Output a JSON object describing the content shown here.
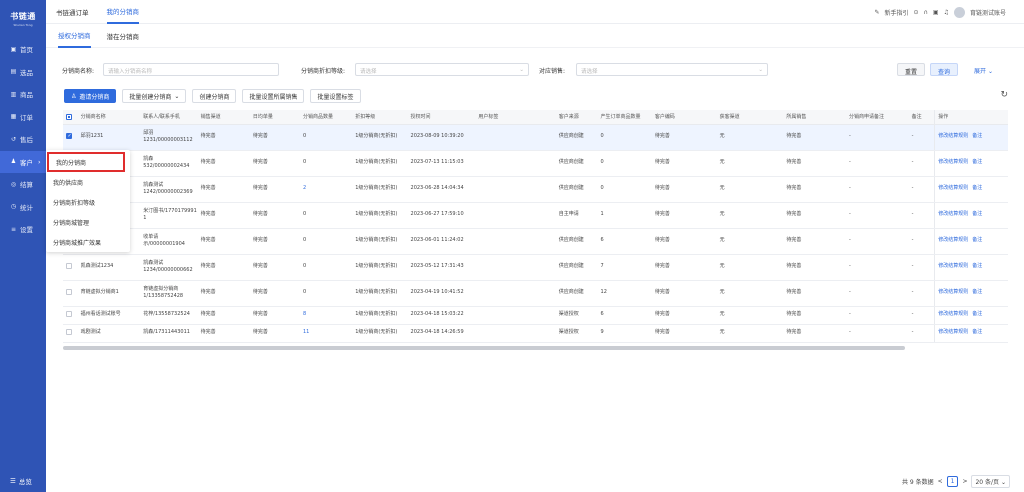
{
  "app": {
    "logo": "书链通",
    "logo_sub": "Shulian Tong"
  },
  "sidebar": {
    "items": [
      {
        "icon": "▣",
        "label": "首页"
      },
      {
        "icon": "▤",
        "label": "选品"
      },
      {
        "icon": "▥",
        "label": "商品"
      },
      {
        "icon": "▦",
        "label": "订单"
      },
      {
        "icon": "↺",
        "label": "售后"
      },
      {
        "icon": "♟",
        "label": "客户"
      },
      {
        "icon": "◎",
        "label": "结算"
      },
      {
        "icon": "◷",
        "label": "统计"
      },
      {
        "icon": "≡",
        "label": "设置"
      }
    ],
    "bottom": "总览",
    "bottom_icon": "☰"
  },
  "topbar": {
    "tabs": [
      "书链通订单",
      "我的分销商"
    ],
    "guide": "新手指引",
    "user": "育链测试账号",
    "icons": [
      "⊙",
      "∩",
      "▣",
      "♫"
    ]
  },
  "subtabs": [
    "授权分销商",
    "潜在分销商"
  ],
  "filters": {
    "name_label": "分销商名称:",
    "name_placeholder": "请输入分销商名称",
    "level_label": "分销商折扣等级:",
    "level_placeholder": "请选择",
    "sales_label": "对应销售:",
    "sales_placeholder": "请选择",
    "reset": "重置",
    "query": "查询",
    "expand": "展开"
  },
  "toolbar": {
    "invite": "邀请分销商",
    "batch_create": "批量创建分销商",
    "create": "创建分销商",
    "batch_sales": "批量设置所属销售",
    "batch_tag": "批量设置标签"
  },
  "table": {
    "headers": [
      "分销商名称",
      "联系人/联系手机",
      "销售渠道",
      "日均单量",
      "分销商品数量",
      "折扣等级",
      "授权时间",
      "用户标签",
      "客户来源",
      "产生订单商品数量",
      "客户编码",
      "获客渠道",
      "所属销售",
      "分销商申请备注",
      "备注",
      "操作"
    ],
    "rows": [
      {
        "name": "邱羽1231",
        "contact": "邱羽1231/00000003112",
        "channel": "待完善",
        "daily": "待完善",
        "count": "0",
        "level": "1级分销商(无折扣)",
        "time": "2023-08-09 10:39:20",
        "tag": "",
        "source": "供应商创建",
        "orders": "0",
        "code": "待完善",
        "acq": "无",
        "sales": "待完善",
        "apply": "-",
        "remark": "-",
        "op1": "修改结算规则",
        "op2": "备注"
      },
      {
        "name": "凯森532",
        "contact": "凯森532/00000002434",
        "channel": "待完善",
        "daily": "待完善",
        "count": "0",
        "level": "1级分销商(无折扣)",
        "time": "2023-07-13 11:15:03",
        "tag": "",
        "source": "供应商创建",
        "orders": "0",
        "code": "待完善",
        "acq": "无",
        "sales": "待完善",
        "apply": "-",
        "remark": "-",
        "op1": "修改结算规则",
        "op2": "备注"
      },
      {
        "name": "凯森测试1242",
        "contact": "凯森测试1242/00000002369",
        "channel": "待完善",
        "daily": "待完善",
        "count": "2",
        "level": "1级分销商(无折扣)",
        "time": "2023-06-28 14:04:34",
        "tag": "",
        "source": "供应商创建",
        "orders": "0",
        "code": "待完善",
        "acq": "无",
        "sales": "待完善",
        "apply": "-",
        "remark": "-",
        "op1": "修改结算规则",
        "op2": "备注"
      },
      {
        "name": "米汀图书",
        "contact": "米汀图书/1770179991 1",
        "channel": "待完善",
        "daily": "待完善",
        "count": "0",
        "level": "1级分销商(无折扣)",
        "time": "2023-06-27 17:59:10",
        "tag": "",
        "source": "自主申请",
        "orders": "1",
        "code": "待完善",
        "acq": "无",
        "sales": "待完善",
        "apply": "-",
        "remark": "-",
        "op1": "修改结算规则",
        "op2": "备注"
      },
      {
        "name": "收单请示",
        "contact": "收单请示/00000001904",
        "channel": "待完善",
        "daily": "待完善",
        "count": "0",
        "level": "1级分销商(无折扣)",
        "time": "2023-06-01 11:24:02",
        "tag": "",
        "source": "供应商创建",
        "orders": "6",
        "code": "待完善",
        "acq": "无",
        "sales": "待完善",
        "apply": "-",
        "remark": "-",
        "op1": "修改结算规则",
        "op2": "备注"
      },
      {
        "name": "凯森测试1234",
        "contact": "凯森测试1234/00000000662",
        "channel": "待完善",
        "daily": "待完善",
        "count": "0",
        "level": "1级分销商(无折扣)",
        "time": "2023-05-12 17:31:43",
        "tag": "",
        "source": "供应商创建",
        "orders": "7",
        "code": "待完善",
        "acq": "无",
        "sales": "待完善",
        "apply": "-",
        "remark": "-",
        "op1": "修改结算规则",
        "op2": "备注"
      },
      {
        "name": "育链虚拟分销商1",
        "contact": "育链虚拟分销商1/13358752428",
        "channel": "待完善",
        "daily": "待完善",
        "count": "0",
        "level": "1级分销商(无折扣)",
        "time": "2023-04-19 10:41:52",
        "tag": "",
        "source": "供应商创建",
        "orders": "12",
        "code": "待完善",
        "acq": "无",
        "sales": "待完善",
        "apply": "-",
        "remark": "-",
        "op1": "修改结算规则",
        "op2": "备注"
      },
      {
        "name": "福州看话测试账号",
        "contact": "花梓/13558732524",
        "channel": "待完善",
        "daily": "待完善",
        "count": "8",
        "level": "1级分销商(无折扣)",
        "time": "2023-04-18 15:03:22",
        "tag": "",
        "source": "渠道授权",
        "orders": "6",
        "code": "待完善",
        "acq": "无",
        "sales": "待完善",
        "apply": "-",
        "remark": "-",
        "op1": "修改结算规则",
        "op2": "备注"
      },
      {
        "name": "戏剧测试",
        "contact": "凯森/17311443011",
        "channel": "待完善",
        "daily": "待完善",
        "count": "11",
        "level": "1级分销商(无折扣)",
        "time": "2023-04-18 14:26:59",
        "tag": "",
        "source": "渠道授权",
        "orders": "9",
        "code": "待完善",
        "acq": "无",
        "sales": "待完善",
        "apply": "-",
        "remark": "-",
        "op1": "修改结算规则",
        "op2": "备注"
      }
    ]
  },
  "dropdown": [
    "我的分销商",
    "我的供应商",
    "分销商折扣等级",
    "分销商城管理",
    "分销商城推广效果"
  ],
  "pager": {
    "total": "共 9 条数据",
    "page": "1",
    "size": "20 条/页",
    "prev": "<",
    "next": ">"
  }
}
